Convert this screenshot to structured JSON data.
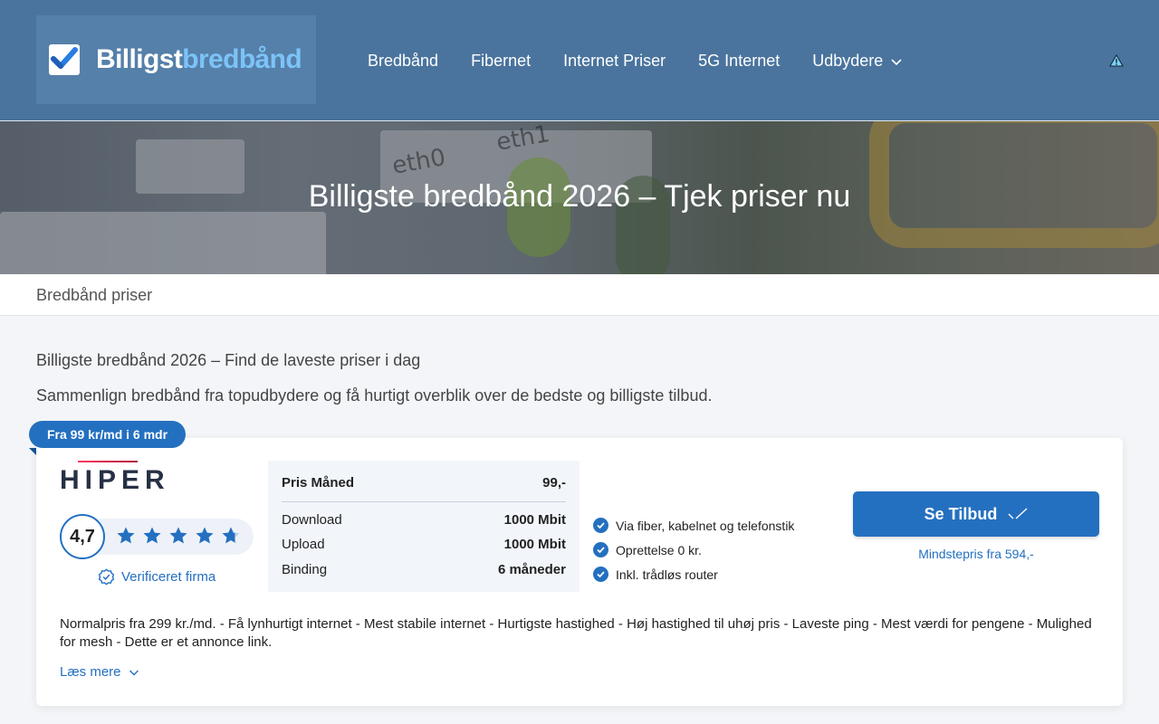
{
  "header": {
    "logo": {
      "part1": "Billigst",
      "part2": "bredbånd"
    },
    "nav": [
      {
        "label": "Bredbånd"
      },
      {
        "label": "Fibernet"
      },
      {
        "label": "Internet Priser"
      },
      {
        "label": "5G Internet"
      },
      {
        "label": "Udbydere",
        "has_dropdown": true
      }
    ]
  },
  "hero": {
    "title": "Billigste bredbånd 2026 – Tjek priser nu",
    "photo_labels": [
      "eth0",
      "eth1"
    ]
  },
  "breadcrumb": {
    "label": "Bredbånd priser"
  },
  "intro": {
    "heading": "Billigste bredbånd 2026 – Find de laveste priser i dag",
    "text": "Sammenlign bredbånd fra topudbydere og få hurtigt overblik over de bedste og billigste tilbud."
  },
  "offer": {
    "ribbon": "Fra 99 kr/md i 6 mdr",
    "provider": "HIPER",
    "rating": "4,7",
    "stars": 4.7,
    "verified": "Verificeret firma",
    "price_head": {
      "label": "Pris Måned",
      "value": "99,-"
    },
    "specs": [
      {
        "label": "Download",
        "value": "1000 Mbit"
      },
      {
        "label": "Upload",
        "value": "1000 Mbit"
      },
      {
        "label": "Binding",
        "value": "6 måneder"
      }
    ],
    "features": [
      "Via fiber, kabelnet og telefonstik",
      "Oprettelse 0 kr.",
      "Inkl. trådløs router"
    ],
    "cta": "Se Tilbud",
    "min_price": "Mindstepris fra 594,-",
    "description": "Normalpris fra 299 kr./md. - Få lynhurtigt internet - Mest stabile internet - Hurtigste hastighed - Høj hastighed til uhøj pris - Laveste ping - Mest værdi for pengene - Mulighed for mesh - Dette er et annonce link.",
    "read_more": "Læs mere"
  },
  "colors": {
    "header_bg": "#4a749d",
    "accent": "#2470c0",
    "logo_accent": "#7cc3f7"
  },
  "icons": [
    "checkbox-logo-icon",
    "chevron-down-icon",
    "warning-icon",
    "star-icon",
    "verified-badge-icon",
    "checkmark-icon"
  ]
}
